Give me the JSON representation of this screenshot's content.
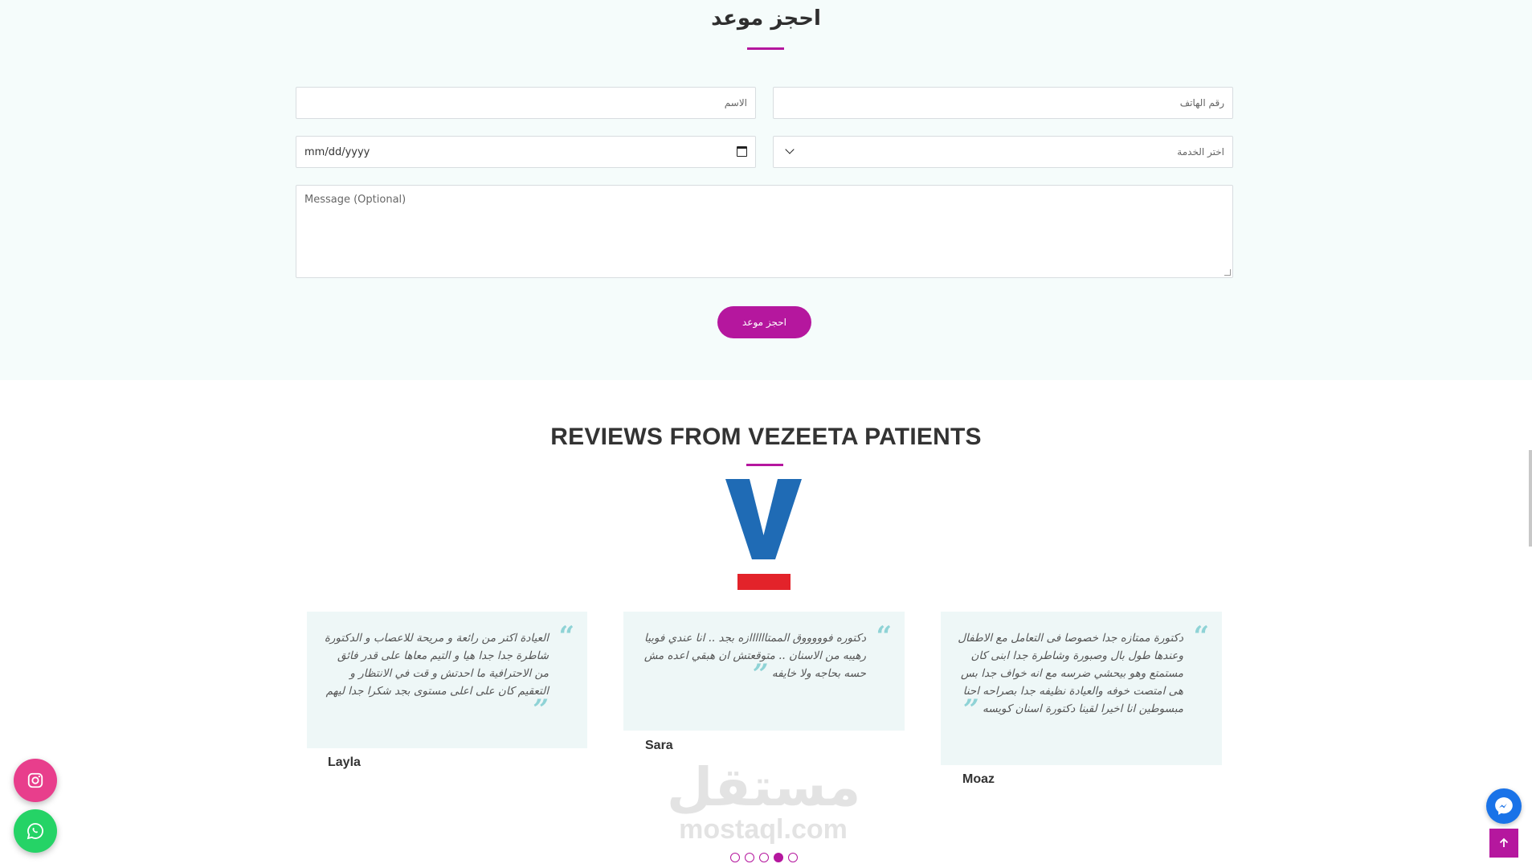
{
  "booking": {
    "title": "احجز موعد",
    "name_placeholder": "الاسم",
    "phone_placeholder": "رقم الهاتف",
    "date_placeholder": "mm/dd/yyyy",
    "service_placeholder": "اختر الخدمة",
    "message_placeholder": "Message (Optional)",
    "submit_label": "احجز موعد"
  },
  "reviews": {
    "title": "REVIEWS FROM VEZEETA PATIENTS",
    "logo_letter": "V",
    "items": [
      {
        "name": "Layla",
        "text": "العيادة اكتر من رائعة و مريحة للاعصاب و الدكتورة شاطرة جدا جدا هيا و التيم معاها على قدر فائق من الاحترافية ما احدتش و قت في الانتظار و التعقيم كان على اعلى مستوى بجد شكرا جدا ليهم"
      },
      {
        "name": "Sara",
        "text": "دكتوره فوووووق الممتاااااازه بجد .. انا عندي فوبيا رهيبه من الاسنان .. متوقعتش ان هبقي اعده مش حسه بحاجه ولا خايفه"
      },
      {
        "name": "Moaz",
        "text": "دكتورة ممتازه جدا خصوصا فى التعامل مع الاطفال وعندها طول بال وصبورة وشاطرة جدا ابنى كان مستمتع وهو بيحشي ضرسه مع انه خواف جدا بس هى امتصت خوفه والعيادة نظيفه جدا بصراحه احنا مبسوطين انا اخيرا لقينا دكتورة اسنان كويسه"
      }
    ],
    "pagination": {
      "count": 5,
      "active": 3
    }
  },
  "watermark": {
    "arabic": "مستقل",
    "latin": "mostaql.com"
  },
  "floating": {
    "instagram_icon": "instagram-icon",
    "whatsapp_icon": "whatsapp-icon",
    "messenger_icon": "messenger-icon",
    "scroll_top_icon": "arrow-up-icon"
  },
  "colors": {
    "accent": "#b5179e",
    "section_bg": "#f5fcfb",
    "card_bg": "#eef7f7",
    "quote": "#8fd3d6",
    "vezeeta_blue": "#1f6bb5",
    "vezeeta_red": "#e3232a",
    "instagram": "#e83e8c",
    "whatsapp": "#25d366",
    "messenger": "#1a73e8"
  }
}
